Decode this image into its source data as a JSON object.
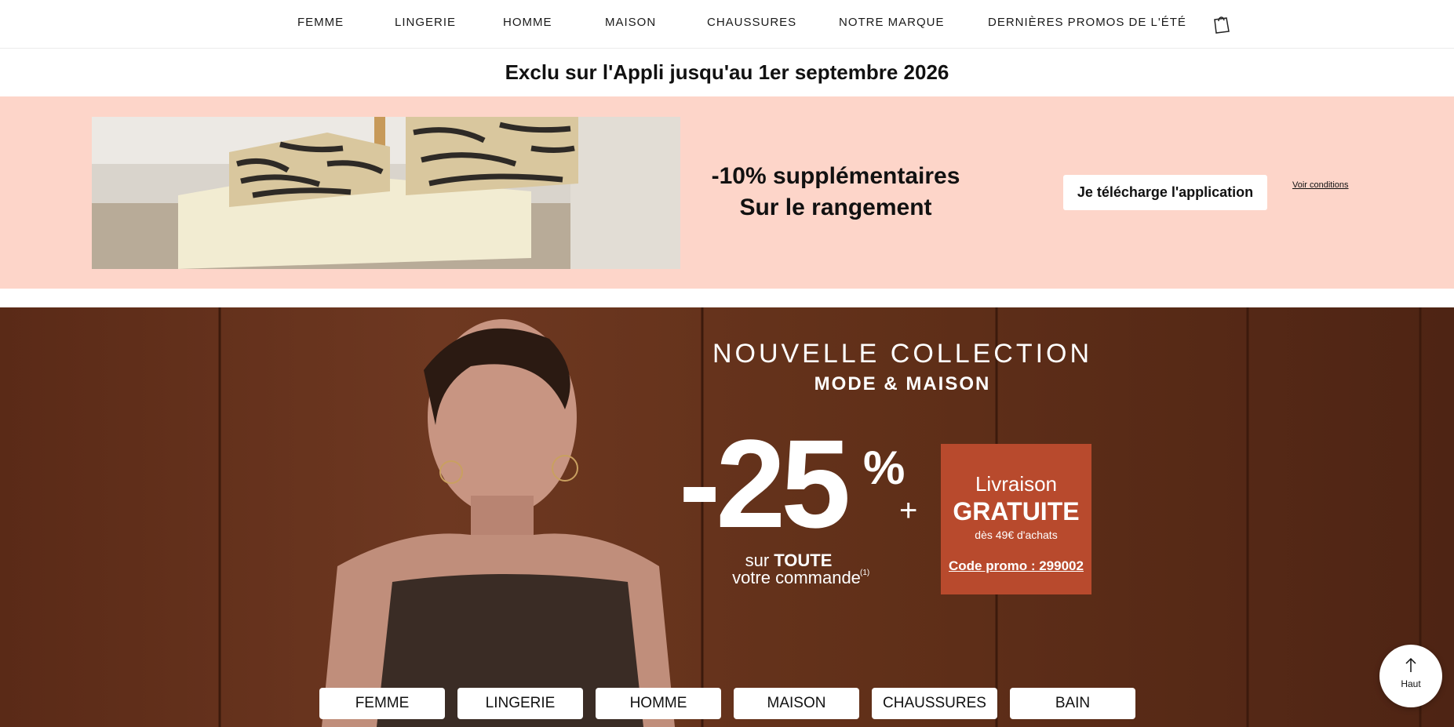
{
  "nav": {
    "items": [
      "FEMME",
      "LINGERIE",
      "HOMME",
      "MAISON",
      "CHAUSSURES",
      "NOTRE MARQUE",
      "DERNIÈRES PROMOS DE L'ÉTÉ"
    ],
    "cart_icon": "shopping-bag-icon"
  },
  "exclu": {
    "text": "Exclu sur l'Appli jusqu'au 1er septembre 2026"
  },
  "promo": {
    "headline_line1": "-10% supplémentaires",
    "headline_line2": "Sur le rangement",
    "button_label": "Je télécharge l'application",
    "conditions_link": "Voir conditions",
    "background_color": "#fdd5c9"
  },
  "hero": {
    "title": "NOUVELLE COLLECTION",
    "subtitle": "MODE & MAISON",
    "discount": "-25",
    "percent": "%",
    "plus": "+",
    "sur": "sur",
    "toute": "TOUTE",
    "votre_commande": "votre commande",
    "note": "(1)",
    "delivery": {
      "line1": "Livraison",
      "line2": "GRATUITE",
      "line3": "dès 49€ d'achats",
      "code": "Code promo : 299002",
      "color": "#b84a2d"
    },
    "categories": [
      "FEMME",
      "LINGERIE",
      "HOMME",
      "MAISON",
      "CHAUSSURES",
      "BAIN"
    ]
  },
  "back_to_top": {
    "label": "Haut",
    "icon": "arrow-up-icon"
  }
}
